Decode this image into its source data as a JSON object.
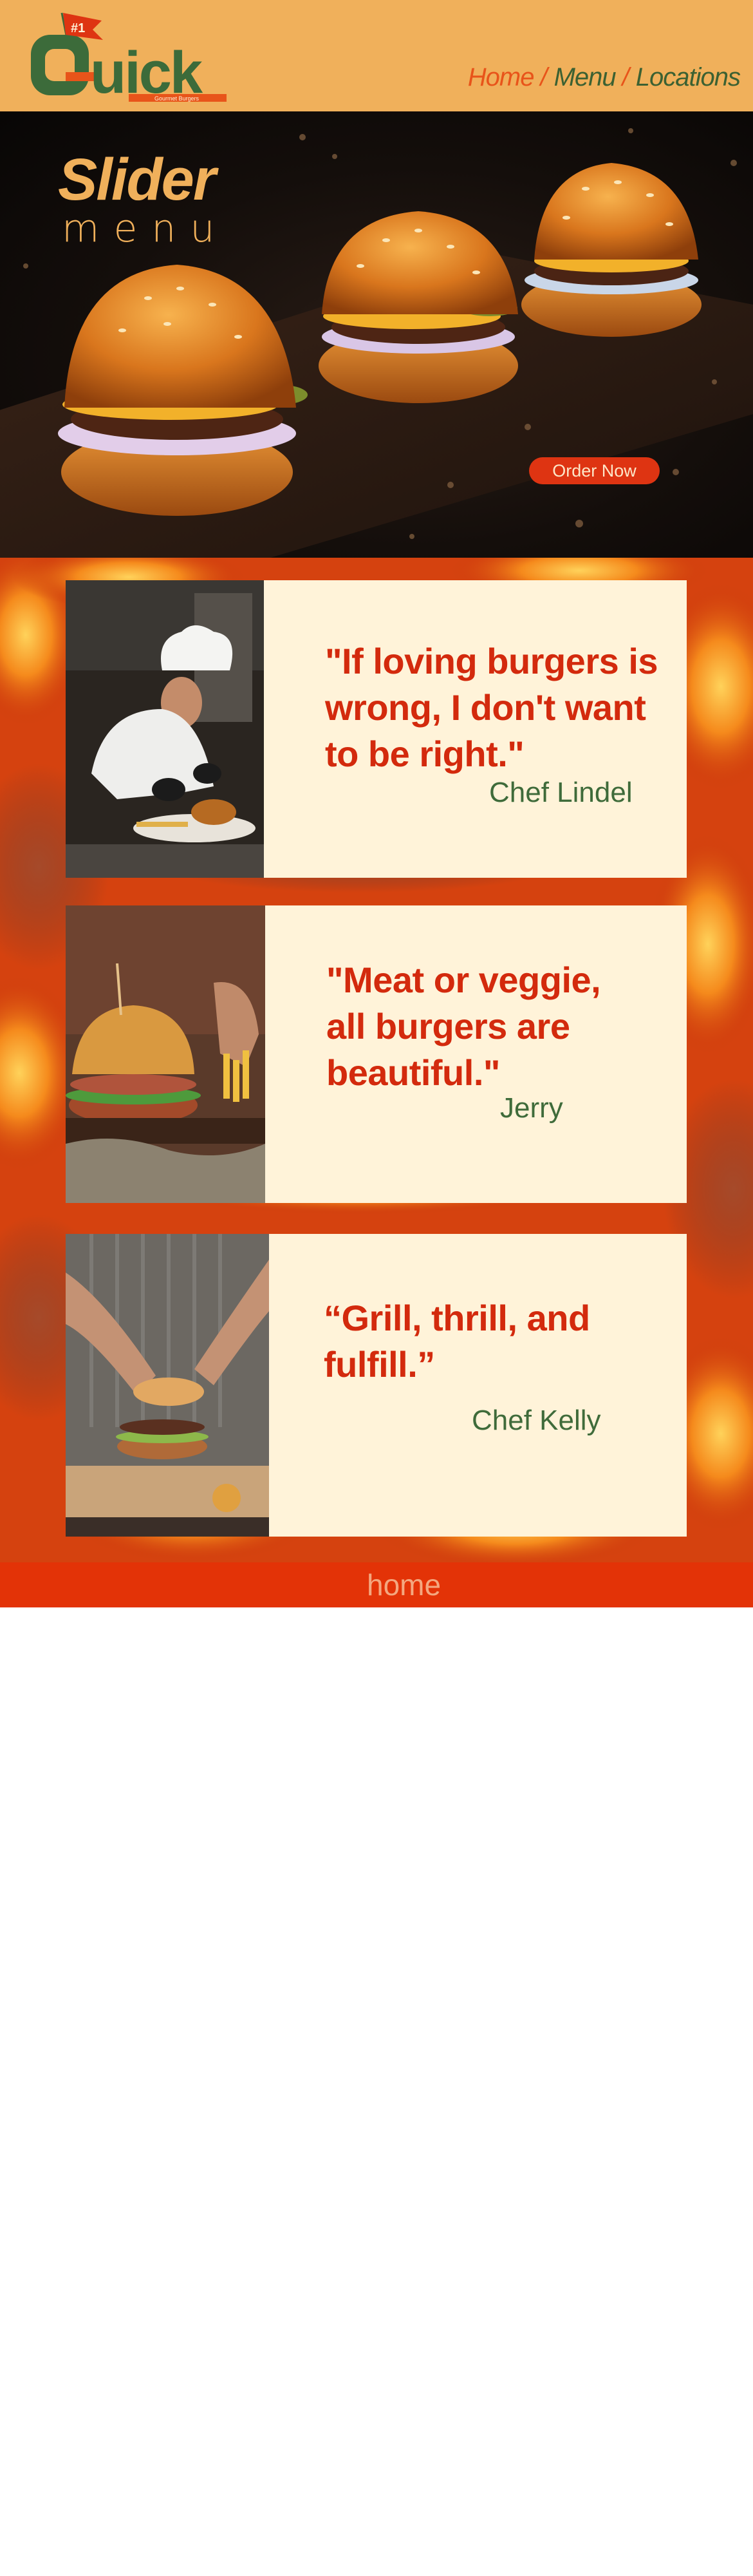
{
  "brand": {
    "name": "Quick",
    "badge": "#1",
    "tagline": "Gourmet Burgers"
  },
  "nav": {
    "items": [
      {
        "label": "Home"
      },
      {
        "label": "Menu"
      },
      {
        "label": "Locations"
      }
    ],
    "separator": "/"
  },
  "hero": {
    "title_big": "Slider",
    "title_small": "menu",
    "cta": "Order Now"
  },
  "testimonials": [
    {
      "quote_lines": [
        "\"If loving burgers is",
        "wrong, I don't want",
        "to be right.\""
      ],
      "author": "Chef Lindel"
    },
    {
      "quote_lines": [
        "\"Meat or veggie,",
        "all burgers are",
        "beautiful.\""
      ],
      "author": "Jerry"
    },
    {
      "quote_lines": [
        "“Grill, thrill, and",
        "fulfill.”"
      ],
      "author": "Chef Kelly"
    }
  ],
  "footer": {
    "link": "home"
  },
  "colors": {
    "header_bg": "#f0b05b",
    "accent_orange": "#e8541a",
    "brand_green": "#3c6132",
    "quote_red": "#d32a0d",
    "card_bg": "#fff3d9",
    "footer_bg": "#e33307"
  }
}
